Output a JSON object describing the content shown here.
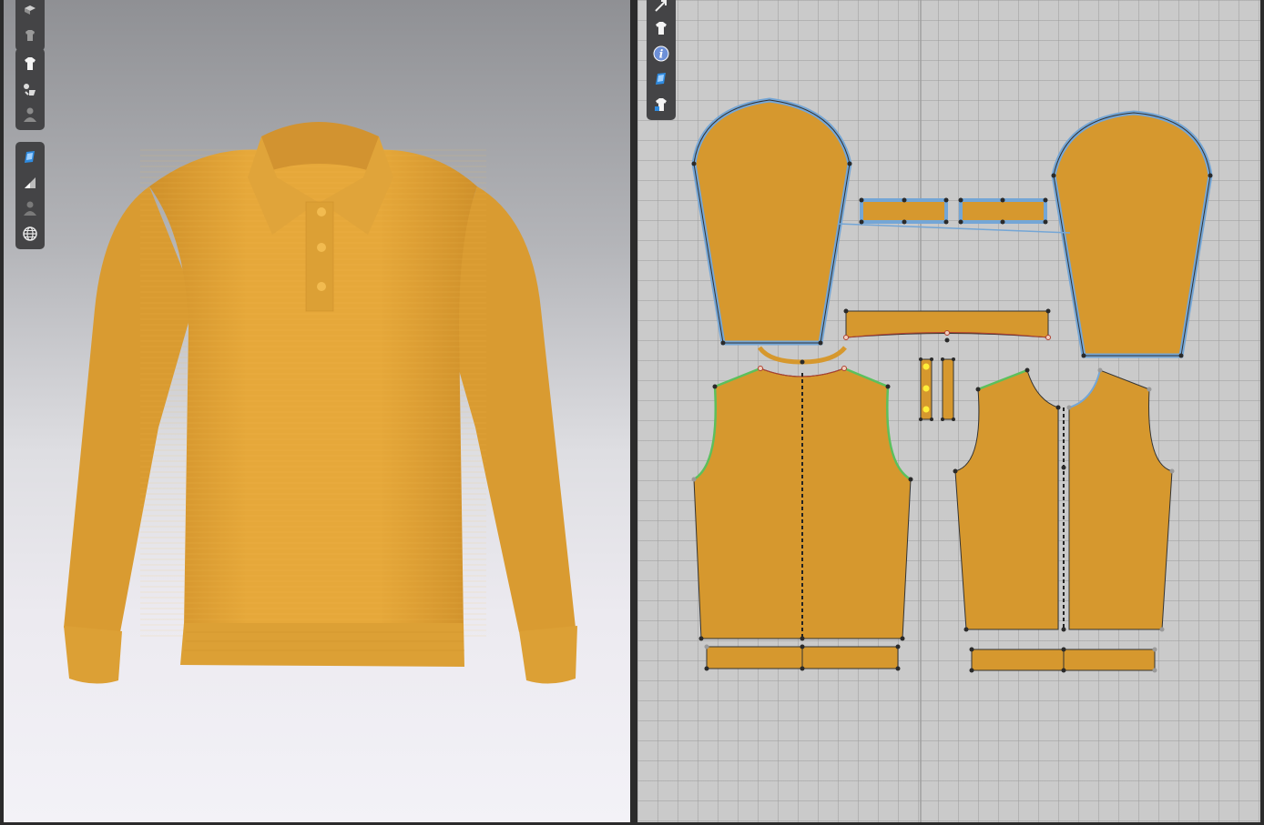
{
  "colors": {
    "fabric": "#e2a436",
    "fabric_2d": "#d6982e",
    "seam_blue": "#74a6d6",
    "seam_green": "#5cc05c",
    "background_2d": "#cacaca",
    "toolbar": "#444446"
  },
  "view3d": {
    "toolbar_groups": [
      [
        "fold-icon",
        "avatar-garment-icon"
      ],
      [
        "shirt-icon",
        "fit-tool-icon",
        "avatar-icon"
      ],
      [
        "texture-icon",
        "light-icon",
        "avatar-silhouette-icon",
        "globe-icon"
      ]
    ]
  },
  "view2d": {
    "toolbar_tools": [
      "arrow-icon",
      "shirt-icon",
      "info-icon",
      "texture-icon",
      "pattern-shirt-icon"
    ]
  }
}
